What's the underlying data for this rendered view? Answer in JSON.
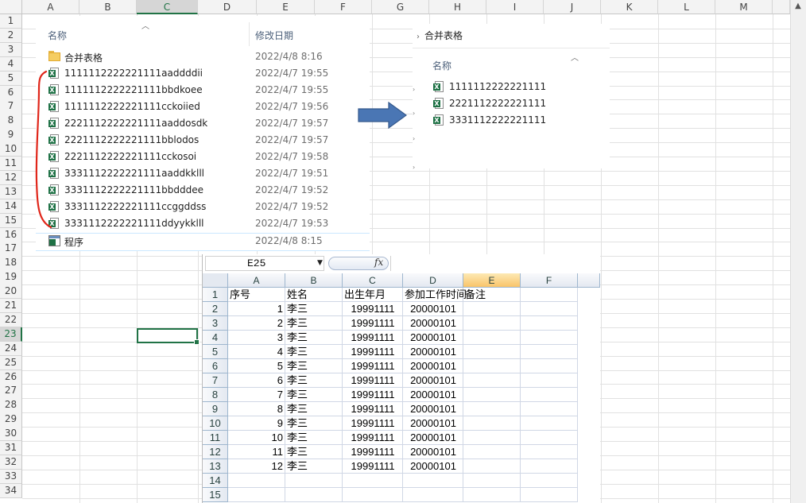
{
  "sheet": {
    "columns": [
      "A",
      "B",
      "C",
      "D",
      "E",
      "F",
      "G",
      "H",
      "I",
      "J",
      "K",
      "L",
      "M"
    ],
    "selected_column": "C",
    "rows": [
      "1",
      "2",
      "3",
      "4",
      "5",
      "6",
      "7",
      "8",
      "9",
      "10",
      "11",
      "12",
      "13",
      "14",
      "15",
      "16",
      "17",
      "18",
      "19",
      "20",
      "21",
      "22",
      "23",
      "24",
      "25",
      "26",
      "27",
      "28",
      "29",
      "30",
      "31",
      "32",
      "33",
      "34"
    ],
    "selected_row": "23"
  },
  "explorer_left": {
    "header_name": "名称",
    "header_date": "修改日期",
    "items": [
      {
        "name": "合并表格",
        "date": "2022/4/8 8:16",
        "icon": "folder-icon"
      },
      {
        "name": "1111112222221111aaddddii",
        "date": "2022/4/7 19:55",
        "icon": "excel-file-icon"
      },
      {
        "name": "1111112222221111bbdkoee",
        "date": "2022/4/7 19:55",
        "icon": "excel-file-icon"
      },
      {
        "name": "1111112222221111cckoiied",
        "date": "2022/4/7 19:56",
        "icon": "excel-file-icon"
      },
      {
        "name": "2221112222221111aaddosdk",
        "date": "2022/4/7 19:57",
        "icon": "excel-file-icon"
      },
      {
        "name": "2221112222221111bblodos",
        "date": "2022/4/7 19:57",
        "icon": "excel-file-icon"
      },
      {
        "name": "2221112222221111cckosoi",
        "date": "2022/4/7 19:58",
        "icon": "excel-file-icon"
      },
      {
        "name": "3331112222221111aaddkklll",
        "date": "2022/4/7 19:51",
        "icon": "excel-file-icon"
      },
      {
        "name": "3331112222221111bbdddee",
        "date": "2022/4/7 19:52",
        "icon": "excel-file-icon"
      },
      {
        "name": "3331112222221111ccggddss",
        "date": "2022/4/7 19:52",
        "icon": "excel-file-icon"
      },
      {
        "name": "3331112222221111ddyykklll",
        "date": "2022/4/7 19:53",
        "icon": "excel-file-icon"
      },
      {
        "name": "程序",
        "date": "2022/4/8 8:15",
        "icon": "excel-macro-icon"
      }
    ]
  },
  "explorer_right": {
    "breadcrumb": "合并表格",
    "header_name": "名称",
    "items": [
      {
        "name": "1111112222221111",
        "icon": "excel-file-icon"
      },
      {
        "name": "2221112222221111",
        "icon": "excel-file-icon"
      },
      {
        "name": "3331112222221111",
        "icon": "excel-file-icon"
      }
    ]
  },
  "embedded_sheet": {
    "name_box": "E25",
    "fx_label": "fx",
    "columns": [
      "A",
      "B",
      "C",
      "D",
      "E",
      "F"
    ],
    "selected_column": "E",
    "row_numbers": [
      "1",
      "2",
      "3",
      "4",
      "5",
      "6",
      "7",
      "8",
      "9",
      "10",
      "11",
      "12",
      "13",
      "14",
      "15"
    ],
    "header_row": [
      "序号",
      "姓名",
      "出生年月",
      "参加工作时间",
      "备注"
    ],
    "data_rows": [
      [
        "1",
        "李三",
        "19991111",
        "20000101"
      ],
      [
        "2",
        "李三",
        "19991111",
        "20000101"
      ],
      [
        "3",
        "李三",
        "19991111",
        "20000101"
      ],
      [
        "4",
        "李三",
        "19991111",
        "20000101"
      ],
      [
        "5",
        "李三",
        "19991111",
        "20000101"
      ],
      [
        "6",
        "李三",
        "19991111",
        "20000101"
      ],
      [
        "7",
        "李三",
        "19991111",
        "20000101"
      ],
      [
        "8",
        "李三",
        "19991111",
        "20000101"
      ],
      [
        "9",
        "李三",
        "19991111",
        "20000101"
      ],
      [
        "10",
        "李三",
        "19991111",
        "20000101"
      ],
      [
        "11",
        "李三",
        "19991111",
        "20000101"
      ],
      [
        "12",
        "李三",
        "19991111",
        "20000101"
      ]
    ]
  },
  "colors": {
    "excel_green": "#217346",
    "annotation_red": "#e0261a",
    "arrow_blue": "#3f6fad"
  }
}
